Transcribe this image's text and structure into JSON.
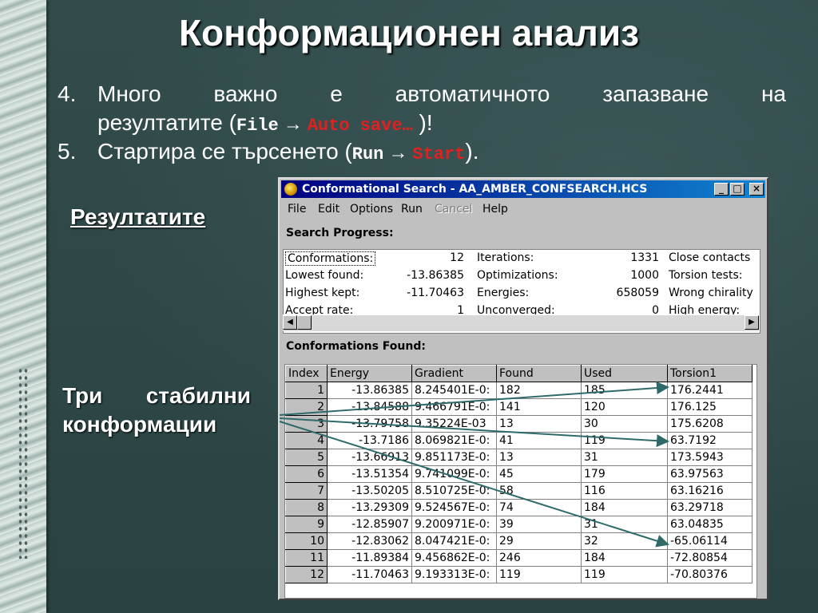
{
  "slide": {
    "title": "Конформационен анализ",
    "item4": {
      "number": "4.",
      "text_a": "Много важно е автоматичното запазване на",
      "text_b": "резултатите (",
      "menu": "File",
      "command": "Auto save…",
      "text_end": ")!"
    },
    "item5": {
      "number": "5.",
      "text_a": "Стартира се търсенето (",
      "menu": "Run",
      "command": "Start",
      "text_end": ")."
    },
    "results_label": "Резултатите",
    "three_label_w1": "Три",
    "three_label_w2": "стабилни",
    "three_label_w3": "конформации",
    "arrow_glyph": "→",
    "accent_red": "#e32020"
  },
  "window": {
    "title": "Conformational Search - AA_AMBER_CONFSEARCH.HCS",
    "buttons": {
      "minimize": "_",
      "maximize": "□",
      "close": "×"
    },
    "menu": [
      "File",
      "Edit",
      "Options",
      "Run",
      "Cancel",
      "Help"
    ],
    "search_progress_label": "Search Progress:",
    "progress": {
      "col1": [
        {
          "label": "Conformations:",
          "value": "12"
        },
        {
          "label": "Lowest found:",
          "value": "-13.86385"
        },
        {
          "label": "Highest kept:",
          "value": "-11.70463"
        },
        {
          "label": "Accept rate:",
          "value": "1"
        }
      ],
      "col2": [
        {
          "label": "Iterations:",
          "value": "1331"
        },
        {
          "label": "Optimizations:",
          "value": "1000"
        },
        {
          "label": "Energies:",
          "value": "658059"
        },
        {
          "label": "Unconverged:",
          "value": "0"
        }
      ],
      "col3": [
        "Close contacts",
        "Torsion tests:",
        "Wrong chirality",
        "High energy:"
      ]
    },
    "scroll_left": "◀",
    "scroll_right": "▶",
    "conformations_found_label": "Conformations Found:",
    "table": {
      "headers": [
        "Index",
        "Energy",
        "Gradient",
        "Found",
        "Used",
        "Torsion1"
      ],
      "rows": [
        [
          "1",
          "-13.86385",
          "8.245401E-0:",
          "182",
          "185",
          "176.2441"
        ],
        [
          "2",
          "-13.84588",
          "9.466791E-0:",
          "141",
          "120",
          "176.125"
        ],
        [
          "3",
          "-13.79758",
          "9.35224E-03",
          "13",
          "30",
          "175.6208"
        ],
        [
          "4",
          "-13.7186",
          "8.069821E-0:",
          "41",
          "119",
          "63.7192"
        ],
        [
          "5",
          "-13.66913",
          "9.851173E-0:",
          "13",
          "31",
          "173.5943"
        ],
        [
          "6",
          "-13.51354",
          "9.741099E-0:",
          "45",
          "179",
          "63.97563"
        ],
        [
          "7",
          "-13.50205",
          "8.510725E-0:",
          "58",
          "116",
          "63.16216"
        ],
        [
          "8",
          "-13.29309",
          "9.524567E-0:",
          "74",
          "184",
          "63.29718"
        ],
        [
          "9",
          "-12.85907",
          "9.200971E-0:",
          "39",
          "31",
          "63.04835"
        ],
        [
          "10",
          "-12.83062",
          "8.047421E-0:",
          "29",
          "32",
          "-65.06114"
        ],
        [
          "11",
          "-11.89384",
          "9.456862E-0:",
          "246",
          "184",
          "-72.80854"
        ],
        [
          "12",
          "-11.70463",
          "9.193313E-0:",
          "119",
          "119",
          "-70.80376"
        ]
      ]
    }
  }
}
